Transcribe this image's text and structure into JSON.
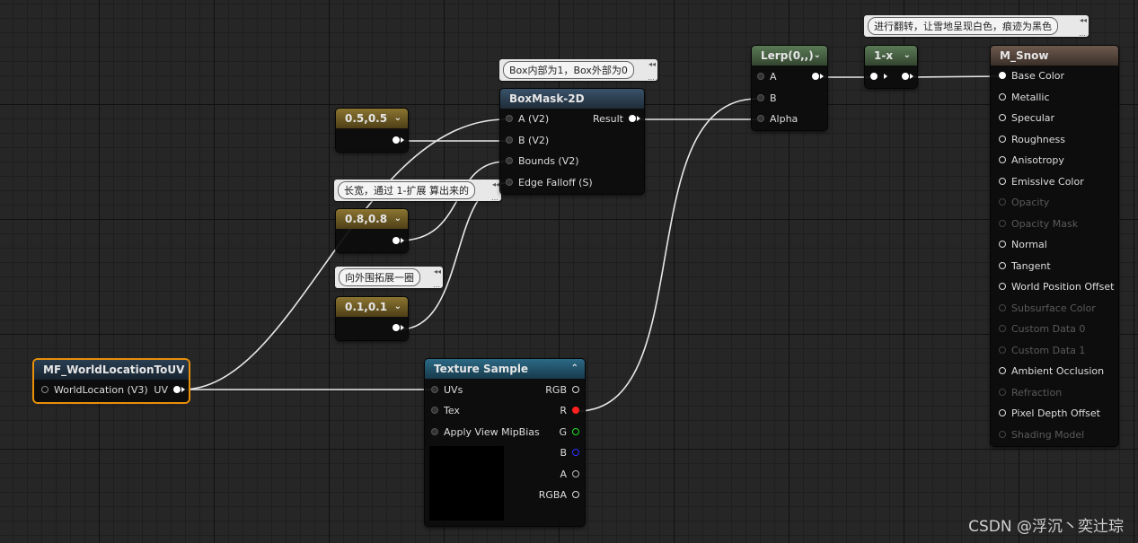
{
  "graph": {
    "nodes": {
      "const1": {
        "title": "0.5,0.5"
      },
      "const2": {
        "title": "0.8,0.8"
      },
      "const3": {
        "title": "0.1,0.1"
      },
      "mf": {
        "title": "MF_WorldLocationToUV",
        "input": "WorldLocation (V3)",
        "output": "UV"
      },
      "boxmask": {
        "title": "BoxMask-2D",
        "inputs": [
          "A (V2)",
          "B (V2)",
          "Bounds (V2)",
          "Edge Falloff (S)"
        ],
        "output": "Result"
      },
      "lerp": {
        "title": "Lerp(0,,)",
        "inputs": [
          "A",
          "B",
          "Alpha"
        ]
      },
      "oneminus": {
        "title": "1-x"
      },
      "texture": {
        "title": "Texture Sample",
        "inputs": [
          "UVs",
          "Tex",
          "Apply View MipBias"
        ],
        "outputs": [
          "RGB",
          "R",
          "G",
          "B",
          "A",
          "RGBA"
        ]
      },
      "material": {
        "title": "M_Snow",
        "inputs": [
          {
            "label": "Base Color",
            "enabled": true
          },
          {
            "label": "Metallic",
            "enabled": true
          },
          {
            "label": "Specular",
            "enabled": true
          },
          {
            "label": "Roughness",
            "enabled": true
          },
          {
            "label": "Anisotropy",
            "enabled": true
          },
          {
            "label": "Emissive Color",
            "enabled": true
          },
          {
            "label": "Opacity",
            "enabled": false
          },
          {
            "label": "Opacity Mask",
            "enabled": false
          },
          {
            "label": "Normal",
            "enabled": true
          },
          {
            "label": "Tangent",
            "enabled": true
          },
          {
            "label": "World Position Offset",
            "enabled": true
          },
          {
            "label": "Subsurface Color",
            "enabled": false
          },
          {
            "label": "Custom Data 0",
            "enabled": false
          },
          {
            "label": "Custom Data 1",
            "enabled": false
          },
          {
            "label": "Ambient Occlusion",
            "enabled": true
          },
          {
            "label": "Refraction",
            "enabled": false
          },
          {
            "label": "Pixel Depth Offset",
            "enabled": true
          },
          {
            "label": "Shading Model",
            "enabled": false
          }
        ]
      }
    },
    "comments": {
      "boxmask": "Box内部为1，Box外部为0",
      "size": "长宽，通过 1-扩展 算出来的",
      "expand": "向外围拓展一圈",
      "invert": "进行翻转，让雪地呈现白色，痕迹为黑色"
    },
    "pin_colors": {
      "r": "#ff2020",
      "g": "#20e020",
      "b": "#3030ff",
      "white": "#ffffff"
    },
    "accent_selected": "#e8900a"
  },
  "watermark": "CSDN @浮沉丶奕辻琮"
}
